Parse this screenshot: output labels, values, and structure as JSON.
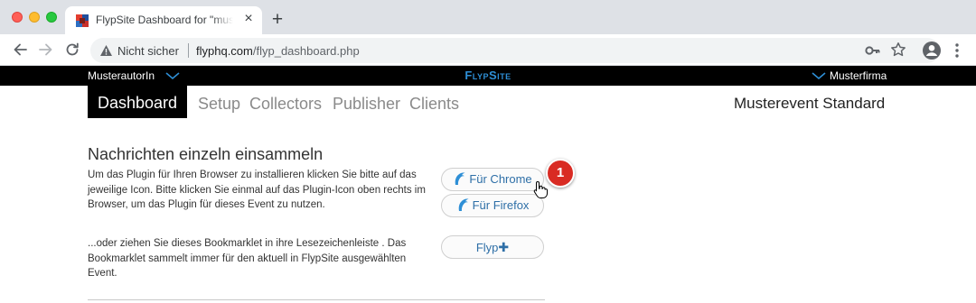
{
  "browser": {
    "tab_title": "FlypSite Dashboard for \"musterautor\"",
    "tab_close": "×",
    "new_tab": "+",
    "security_label": "Nicht sicher",
    "url_host": "flyphq.com",
    "url_path": "/flyp_dashboard.php"
  },
  "site": {
    "author": "MusterautorIn",
    "brand": "FlypSite",
    "company": "Musterfirma",
    "brand_color": "#2e8fd6"
  },
  "nav": {
    "active": "Dashboard",
    "items": [
      "Setup",
      "Collectors",
      "Publisher",
      "Clients"
    ],
    "event": "Musterevent Standard"
  },
  "content": {
    "section_title": "Nachrichten einzeln einsammeln",
    "paragraph1": "Um das Plugin für Ihren Browser zu installieren klicken Sie bitte auf das jeweilige Icon. Bitte klicken Sie einmal auf das Plugin-Icon oben rechts im Browser, um das Plugin für dieses Event zu nutzen.",
    "paragraph2": "...oder ziehen Sie dieses Bookmarklet in ihre Lesezeichenleiste . Das Bookmarklet sammelt immer für den aktuell in FlypSite ausgewählten Event.",
    "chrome_button": "Für Chrome",
    "firefox_button": "Für Firefox",
    "flyp_button": "Flyp",
    "flyp_plus": "✚",
    "callout_number": "1"
  },
  "icons": {
    "warning": "warning-triangle-icon",
    "key": "key-icon",
    "star": "star-icon",
    "profile": "profile-icon",
    "menu": "kebab-menu-icon",
    "dolphin": "dolphin-icon",
    "cursor": "hand-pointer-icon"
  }
}
